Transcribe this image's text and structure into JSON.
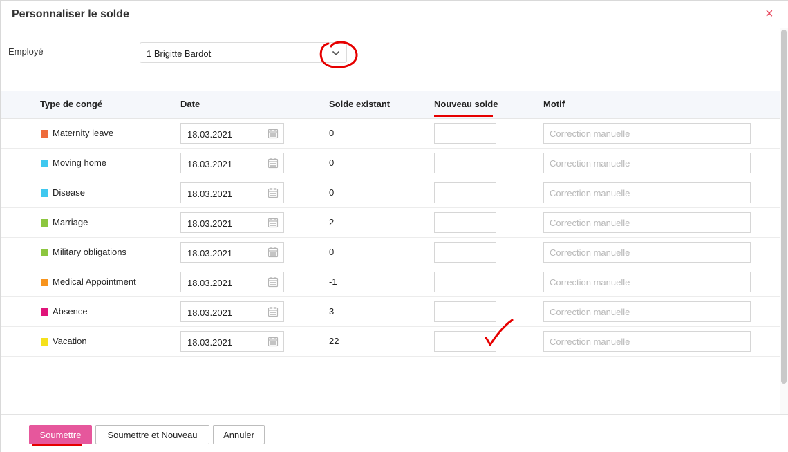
{
  "dialog": {
    "title": "Personnaliser le solde",
    "close_icon": "×"
  },
  "employee": {
    "label": "Employé",
    "selected": "1 Brigitte Bardot"
  },
  "table": {
    "headers": {
      "type": "Type de congé",
      "date": "Date",
      "existing": "Solde existant",
      "new": "Nouveau solde",
      "reason": "Motif"
    },
    "rows": [
      {
        "type": "Maternity leave",
        "color": "#ee6b3b",
        "date": "18.03.2021",
        "existing": "0",
        "new": "",
        "reason_placeholder": "Correction manuelle"
      },
      {
        "type": "Moving home",
        "color": "#3fc8ef",
        "date": "18.03.2021",
        "existing": "0",
        "new": "",
        "reason_placeholder": "Correction manuelle"
      },
      {
        "type": "Disease",
        "color": "#3fc8ef",
        "date": "18.03.2021",
        "existing": "0",
        "new": "",
        "reason_placeholder": "Correction manuelle"
      },
      {
        "type": "Marriage",
        "color": "#8cc63f",
        "date": "18.03.2021",
        "existing": "2",
        "new": "",
        "reason_placeholder": "Correction manuelle"
      },
      {
        "type": "Military obligations",
        "color": "#8cc63f",
        "date": "18.03.2021",
        "existing": "0",
        "new": "",
        "reason_placeholder": "Correction manuelle"
      },
      {
        "type": "Medical Appointment",
        "color": "#f7941d",
        "date": "18.03.2021",
        "existing": "-1",
        "new": "",
        "reason_placeholder": "Correction manuelle"
      },
      {
        "type": "Absence",
        "color": "#e0147a",
        "date": "18.03.2021",
        "existing": "3",
        "new": "",
        "reason_placeholder": "Correction manuelle"
      },
      {
        "type": "Vacation",
        "color": "#f5e11c",
        "date": "18.03.2021",
        "existing": "22",
        "new": "",
        "reason_placeholder": "Correction manuelle"
      }
    ]
  },
  "footer": {
    "submit": "Soumettre",
    "submit_new": "Soumettre et Nouveau",
    "cancel": "Annuler"
  },
  "colors": {
    "primary": "#e6579c",
    "annotation": "#e60000",
    "close": "#e8465c"
  }
}
